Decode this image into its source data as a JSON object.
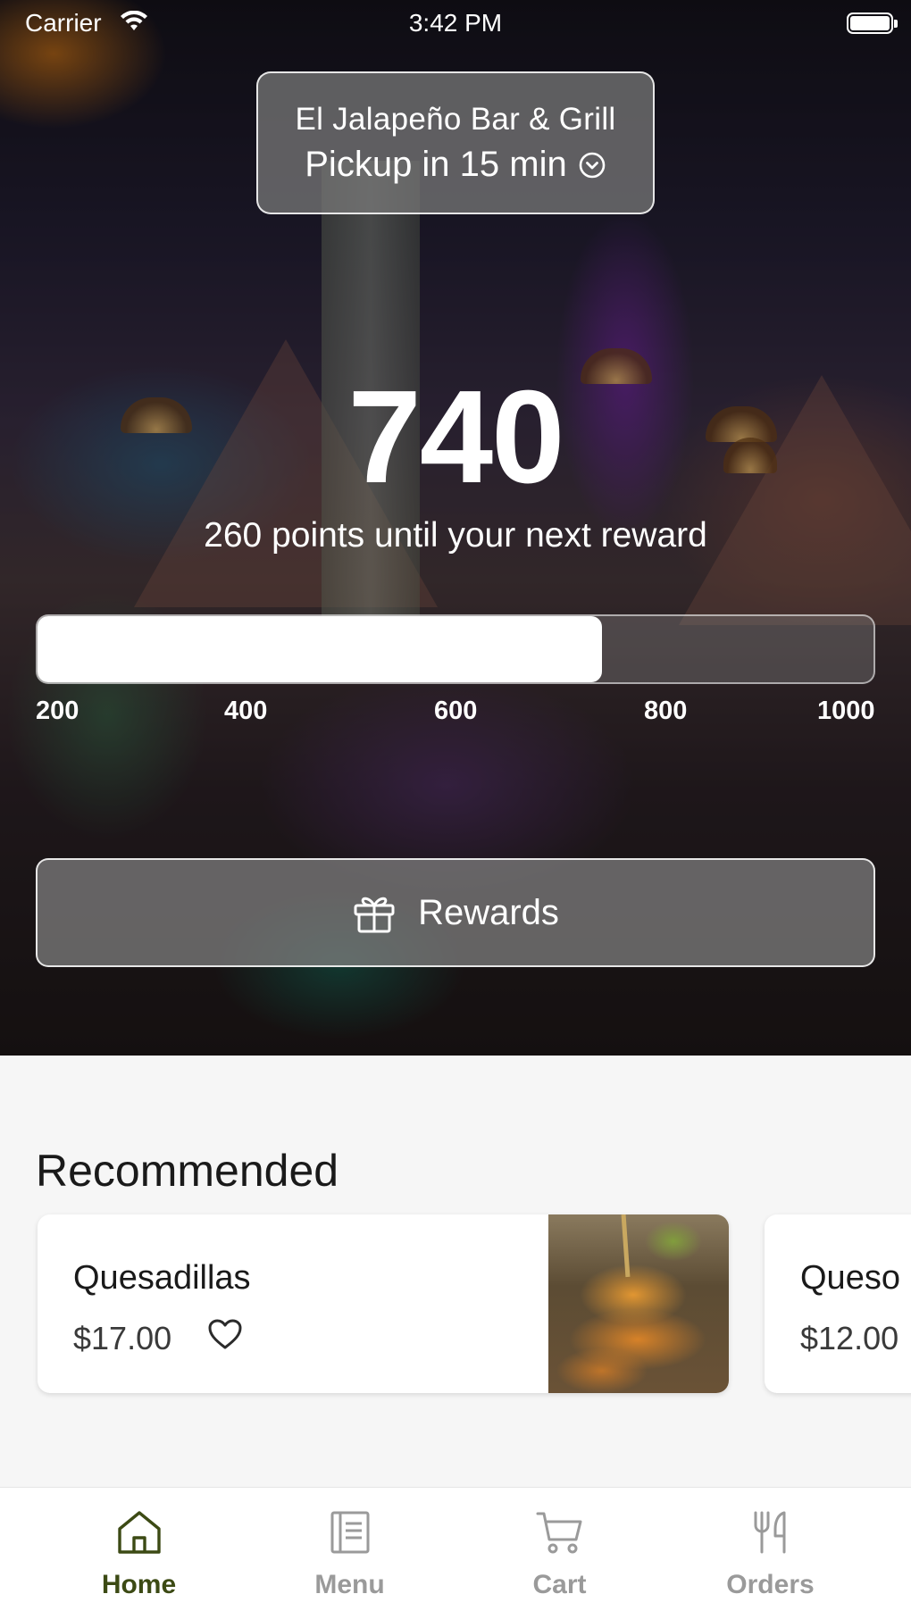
{
  "status_bar": {
    "carrier": "Carrier",
    "time": "3:42 PM",
    "wifi_icon": "wifi-icon",
    "battery_icon": "battery-full-icon"
  },
  "location": {
    "name": "El Jalapeño Bar & Grill",
    "pickup": "Pickup in 15 min",
    "chevron_icon": "chevron-down-circle-icon"
  },
  "points": {
    "value": "740",
    "caption": "260 points until your next reward",
    "progress": {
      "min": 200,
      "max": 1000,
      "current": 740,
      "ticks": [
        "200",
        "400",
        "600",
        "800",
        "1000"
      ]
    }
  },
  "rewards_button": {
    "label": "Rewards",
    "icon": "gift-icon"
  },
  "recommended": {
    "title": "Recommended",
    "items": [
      {
        "name": "Quesadillas",
        "price": "$17.00",
        "favorite_icon": "heart-outline-icon"
      },
      {
        "name": "Queso",
        "price": "$12.00"
      }
    ]
  },
  "tab_bar": {
    "active_color": "#3c4a14",
    "inactive_color": "#9a9a9a",
    "tabs": [
      {
        "label": "Home",
        "icon": "home-icon",
        "active": true
      },
      {
        "label": "Menu",
        "icon": "menu-book-icon",
        "active": false
      },
      {
        "label": "Cart",
        "icon": "cart-icon",
        "active": false
      },
      {
        "label": "Orders",
        "icon": "fork-knife-icon",
        "active": false
      }
    ]
  }
}
